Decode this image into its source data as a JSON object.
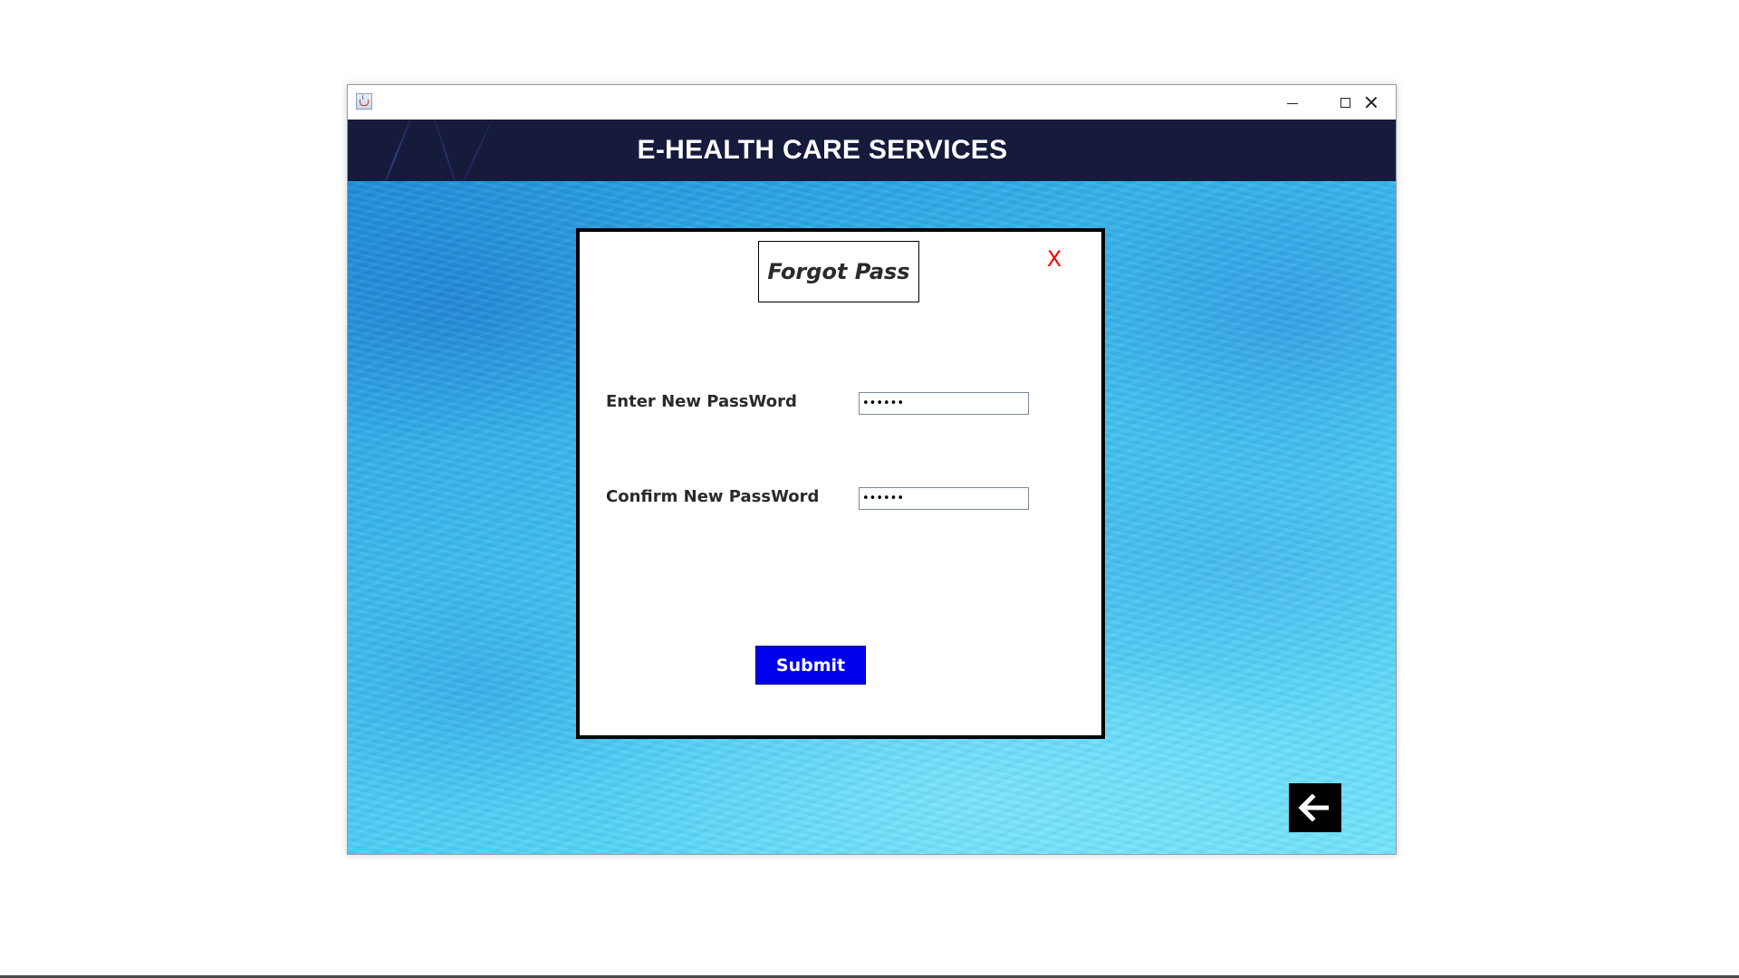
{
  "window": {
    "title_icon": "java-cup-icon",
    "controls": {
      "minimize": "minimize-icon",
      "maximize": "maximize-icon",
      "close": "close-icon"
    }
  },
  "header": {
    "title": "E-HEALTH CARE SERVICES"
  },
  "dialog": {
    "title": "Forgot Pass",
    "close_label": "X",
    "fields": [
      {
        "label": "Enter New PassWord",
        "value": "••••••",
        "type": "password"
      },
      {
        "label": "Confirm New PassWord",
        "value": "••••••",
        "type": "password"
      }
    ],
    "submit_label": "Submit"
  },
  "back_button": {
    "icon": "arrow-left-icon"
  },
  "colors": {
    "header_bg": "#161b3c",
    "submit_bg": "#0000f0",
    "close_x": "#ff0000",
    "back_bg": "#000000"
  }
}
